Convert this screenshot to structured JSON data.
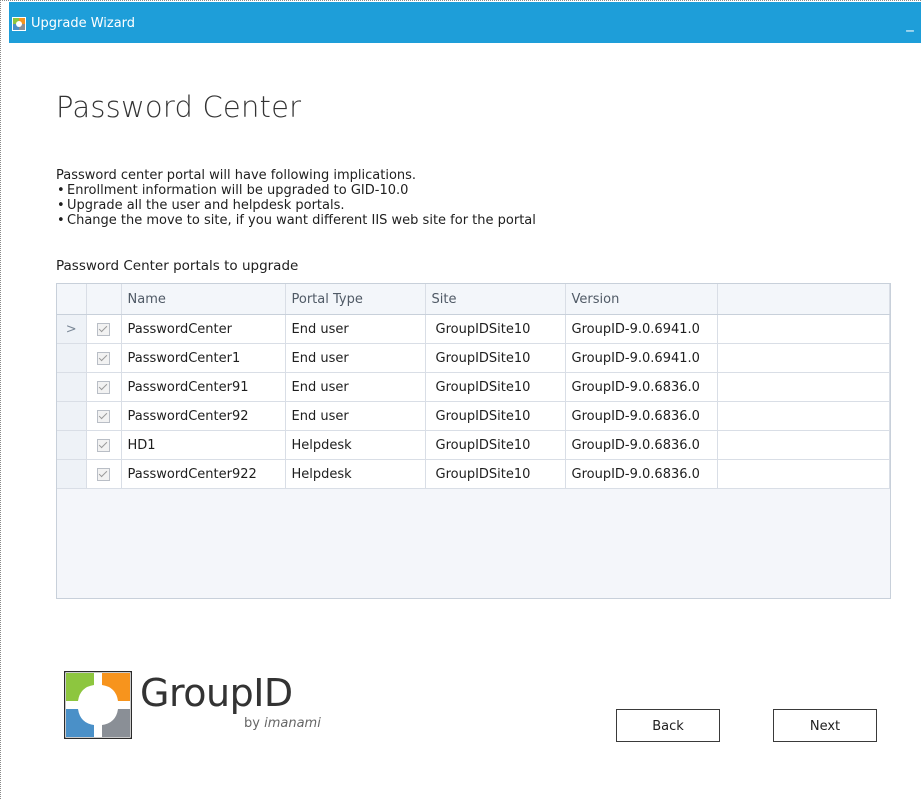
{
  "window": {
    "title": "Upgrade Wizard",
    "minimize_glyph": "_"
  },
  "page": {
    "title": "Password Center",
    "intro": "Password center portal will have following implications.",
    "bullets": [
      "Enrollment information will be upgraded to GID-10.0",
      "Upgrade all the user and helpdesk portals.",
      "Change the move to site, if you want different IIS web site for the portal"
    ],
    "grid_label": "Password Center portals to upgrade"
  },
  "grid": {
    "columns": [
      "Name",
      "Portal Type",
      "Site",
      "Version"
    ],
    "current_row_marker": ">",
    "rows": [
      {
        "checked": true,
        "name": "PasswordCenter",
        "type": "End user",
        "site": "GroupIDSite10",
        "version": "GroupID-9.0.6941.0"
      },
      {
        "checked": true,
        "name": "PasswordCenter1",
        "type": "End user",
        "site": "GroupIDSite10",
        "version": "GroupID-9.0.6941.0"
      },
      {
        "checked": true,
        "name": "PasswordCenter91",
        "type": "End user",
        "site": "GroupIDSite10",
        "version": "GroupID-9.0.6836.0"
      },
      {
        "checked": true,
        "name": "PasswordCenter92",
        "type": "End user",
        "site": "GroupIDSite10",
        "version": "GroupID-9.0.6836.0"
      },
      {
        "checked": true,
        "name": "HD1",
        "type": "Helpdesk",
        "site": "GroupIDSite10",
        "version": "GroupID-9.0.6836.0"
      },
      {
        "checked": true,
        "name": "PasswordCenter922",
        "type": "Helpdesk",
        "site": "GroupIDSite10",
        "version": "GroupID-9.0.6836.0"
      }
    ]
  },
  "logo": {
    "brand": "GroupID",
    "by": "by",
    "company": "imanami",
    "colors": {
      "green": "#8dc63f",
      "orange": "#f7941d",
      "blue": "#4a90c8",
      "gray": "#8a8f96"
    }
  },
  "buttons": {
    "back": "Back",
    "next": "Next"
  },
  "colors": {
    "titlebar": "#1e9ed9"
  }
}
